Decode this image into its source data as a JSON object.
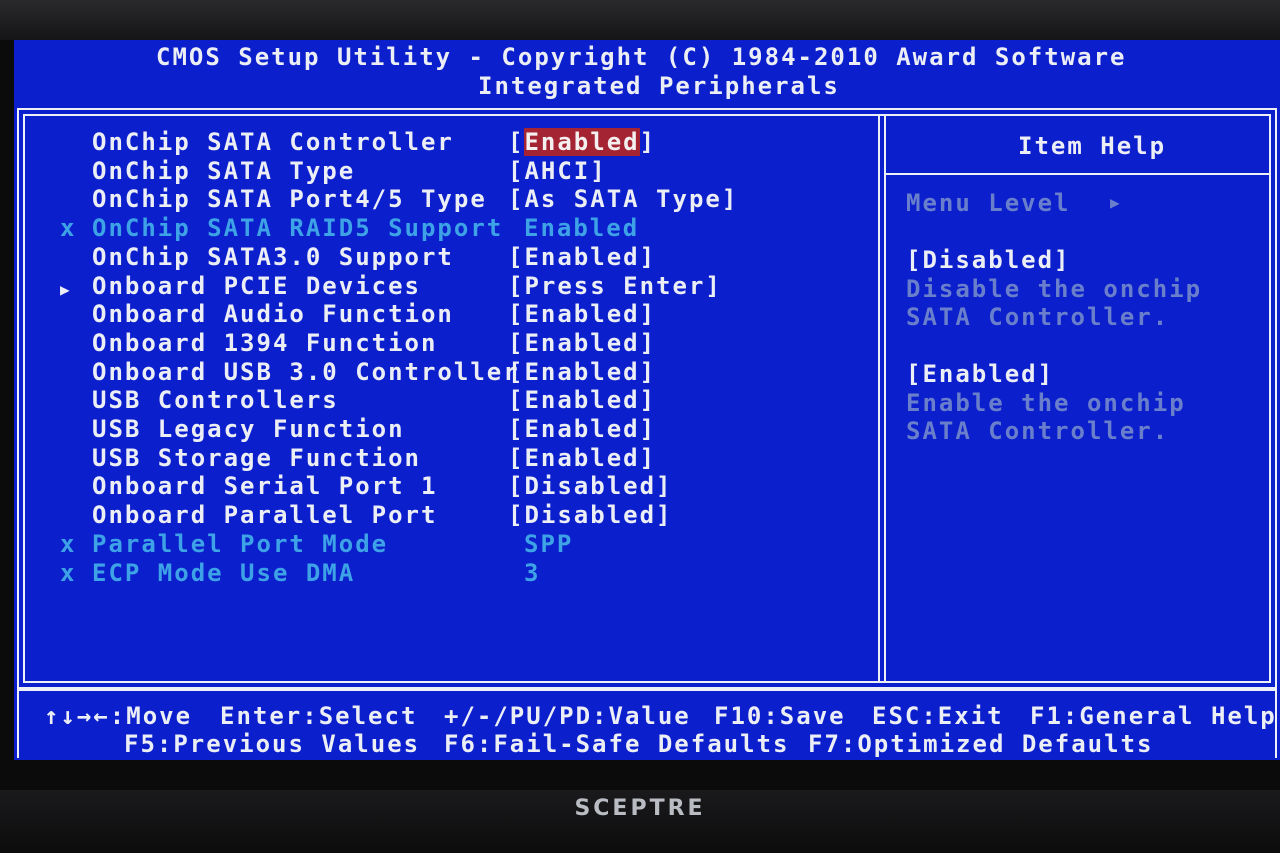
{
  "header": {
    "title": "CMOS Setup Utility - Copyright (C) 1984-2010 Award Software",
    "subtitle": "Integrated Peripherals"
  },
  "items": [
    {
      "label": "OnChip SATA Controller",
      "value": "[Enabled]",
      "disabled": false,
      "submenu": false,
      "selected": true
    },
    {
      "label": "OnChip SATA Type",
      "value": "[AHCI]",
      "disabled": false,
      "submenu": false,
      "selected": false
    },
    {
      "label": "OnChip SATA Port4/5 Type",
      "value": "[As SATA Type]",
      "disabled": false,
      "submenu": false,
      "selected": false
    },
    {
      "label": "OnChip SATA RAID5 Support",
      "value": "Enabled",
      "disabled": true,
      "submenu": false,
      "selected": false
    },
    {
      "label": "OnChip SATA3.0 Support",
      "value": "[Enabled]",
      "disabled": false,
      "submenu": false,
      "selected": false
    },
    {
      "label": "Onboard PCIE Devices",
      "value": "[Press Enter]",
      "disabled": false,
      "submenu": true,
      "selected": false
    },
    {
      "label": "Onboard Audio Function",
      "value": "[Enabled]",
      "disabled": false,
      "submenu": false,
      "selected": false
    },
    {
      "label": "Onboard 1394 Function",
      "value": "[Enabled]",
      "disabled": false,
      "submenu": false,
      "selected": false
    },
    {
      "label": "Onboard USB 3.0 Controller",
      "value": "[Enabled]",
      "disabled": false,
      "submenu": false,
      "selected": false
    },
    {
      "label": "USB Controllers",
      "value": "[Enabled]",
      "disabled": false,
      "submenu": false,
      "selected": false
    },
    {
      "label": "USB Legacy Function",
      "value": "[Enabled]",
      "disabled": false,
      "submenu": false,
      "selected": false
    },
    {
      "label": "USB Storage Function",
      "value": "[Enabled]",
      "disabled": false,
      "submenu": false,
      "selected": false
    },
    {
      "label": "Onboard Serial Port 1",
      "value": "[Disabled]",
      "disabled": false,
      "submenu": false,
      "selected": false
    },
    {
      "label": "Onboard Parallel Port",
      "value": "[Disabled]",
      "disabled": false,
      "submenu": false,
      "selected": false
    },
    {
      "label": "Parallel Port Mode",
      "value": "SPP",
      "disabled": true,
      "submenu": false,
      "selected": false
    },
    {
      "label": "ECP Mode Use DMA",
      "value": "3",
      "disabled": true,
      "submenu": false,
      "selected": false
    }
  ],
  "markers": {
    "disabled": "x",
    "submenu": "▶"
  },
  "help": {
    "title": "Item Help",
    "menu_level_label": "Menu Level",
    "menu_level_icon": "▶",
    "entries": [
      {
        "option": "[Disabled]",
        "line1": "Disable the onchip",
        "line2": "SATA Controller."
      },
      {
        "option": "[Enabled]",
        "line1": "Enable the onchip",
        "line2": "SATA Controller."
      }
    ]
  },
  "footer": {
    "row1": [
      {
        "key": "↑↓→←",
        "desc": ":Move"
      },
      {
        "key": "Enter",
        "desc": ":Select"
      },
      {
        "key": "+/-/PU/PD",
        "desc": ":Value"
      },
      {
        "key": "F10",
        "desc": ":Save"
      },
      {
        "key": "ESC",
        "desc": ":Exit"
      },
      {
        "key": "F1",
        "desc": ":General Help"
      }
    ],
    "row2": [
      {
        "key": "F5",
        "desc": ":Previous Values"
      },
      {
        "key": "F6",
        "desc": ":Fail-Safe Defaults"
      },
      {
        "key": "F7",
        "desc": ":Optimized Defaults"
      }
    ]
  },
  "monitor": {
    "brand": "SCEPTRE"
  },
  "colors": {
    "screen_bg": "#0c1fcc",
    "text": "#eceef5",
    "disabled_text": "#3da3e6",
    "help_text": "#6a7fcc",
    "selection_bg": "#a42434"
  }
}
